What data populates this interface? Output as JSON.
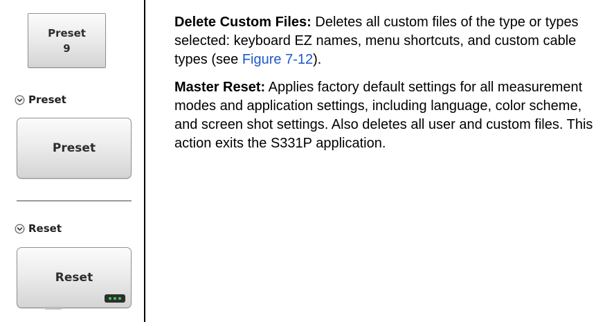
{
  "left_panel": {
    "small_button": {
      "line1": "Preset",
      "line2": "9"
    },
    "preset_section": {
      "label": "Preset",
      "button_label": "Preset"
    },
    "reset_section": {
      "label": "Reset",
      "button_label": "Reset"
    }
  },
  "right_panel": {
    "delete_custom_files": {
      "title": "Delete Custom Files:",
      "text_before_link": " Deletes all custom files of the type or types selected: keyboard EZ names, menu shortcuts, and custom cable types (see ",
      "link": "Figure 7-12",
      "text_after_link": ")."
    },
    "master_reset": {
      "title": "Master Reset:",
      "text": " Applies factory default settings for all measurement modes and application settings, including language, color scheme, and screen shot settings. Also deletes all user and custom files. This action exits the S331P application."
    }
  },
  "colors": {
    "link": "#1f57c8",
    "more_indicator": "#34d058"
  },
  "icons": {
    "section_chevron": "chevron-down-circle-icon",
    "more_options": "more-dots-icon"
  }
}
